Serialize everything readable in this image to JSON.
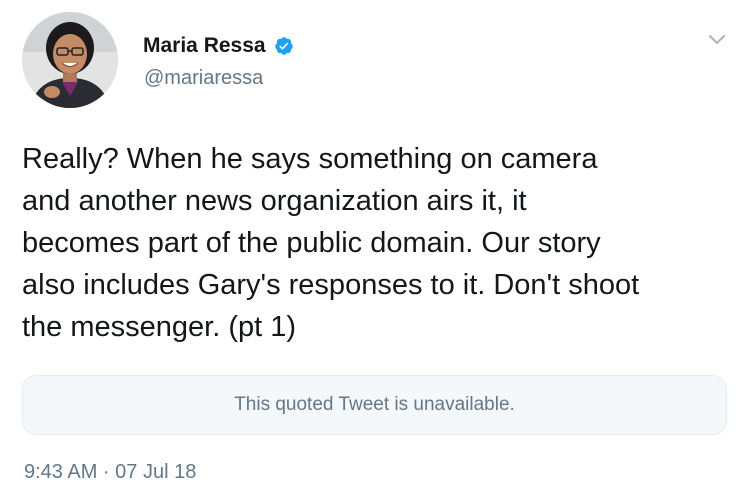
{
  "author": {
    "name": "Maria Ressa",
    "handle": "@mariaressa",
    "verified": true,
    "verified_color": "#1da1f2"
  },
  "menu": {
    "icon": "chevron-down-icon"
  },
  "tweet": {
    "text": "Really? When he says something on camera\nand another news organization airs it, it\nbecomes part of the public domain. Our story\nalso includes Gary's responses to it. Don't shoot\nthe messenger. (pt 1)"
  },
  "quoted_tweet": {
    "text": "This quoted Tweet is unavailable."
  },
  "meta": {
    "timestamp": "9:43 AM · 07 Jul 18"
  },
  "colors": {
    "text_primary": "#14171a",
    "text_secondary": "#657786",
    "quoted_bg": "#f5f8fa"
  }
}
